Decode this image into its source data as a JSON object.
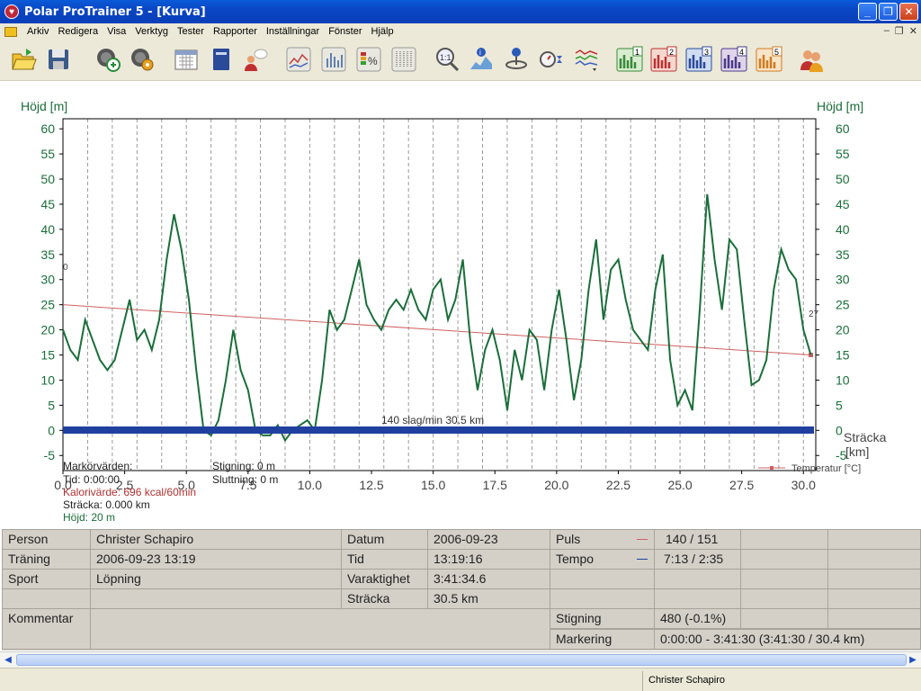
{
  "window": {
    "title": "Polar ProTrainer 5 - [Kurva]"
  },
  "menu": {
    "items": [
      "Arkiv",
      "Redigera",
      "Visa",
      "Verktyg",
      "Tester",
      "Rapporter",
      "Inställningar",
      "Fönster",
      "Hjälp"
    ]
  },
  "toolbar": {
    "buttons": [
      "open-folder-icon",
      "save-icon",
      "sync-icon",
      "settings-icon",
      "calendar-icon",
      "diary-icon",
      "person-icon",
      "speech-icon",
      "curve-view-icon",
      "bar-view-icon",
      "percent-view-icon",
      "table-view-icon",
      "zoom-icon",
      "info-marker-icon",
      "cursor-icon",
      "stopwatch-icon",
      "multi-curve-icon",
      "zone-1-icon",
      "zone-2-icon",
      "zone-3-icon",
      "zone-4-icon",
      "zone-5-icon",
      "users-icon"
    ],
    "zone_labels": [
      "1",
      "2",
      "3",
      "4",
      "5"
    ]
  },
  "chart": {
    "ylabel_left": "Höjd [m]",
    "ylabel_right": "Höjd [m]",
    "xlabel_line1": "Sträcka",
    "xlabel_line2": "[km]",
    "bar_label": "140 slag/min 30.5 km",
    "temp_start_label": "0",
    "temp_end_label": "27",
    "legend_label": "Temperatur [°C]",
    "colors": {
      "altitude": "#1a6e3a",
      "temperature": "#d06060",
      "bar": "#2040a0",
      "axis_text": "#1a6e3a"
    }
  },
  "chart_data": {
    "type": "line",
    "xlim": [
      0,
      30.5
    ],
    "ylim": [
      -8,
      62
    ],
    "xticks": [
      "0.0",
      "2.5",
      "5.0",
      "7.5",
      "10.0",
      "12.5",
      "15.0",
      "17.5",
      "20.0",
      "22.5",
      "25.0",
      "27.5",
      "30.0"
    ],
    "yticks": [
      "60",
      "55",
      "50",
      "45",
      "40",
      "35",
      "30",
      "25",
      "20",
      "15",
      "10",
      "5",
      "0",
      "-5"
    ],
    "series": [
      {
        "name": "Höjd",
        "x": [
          0,
          0.3,
          0.6,
          0.9,
          1.2,
          1.5,
          1.8,
          2.1,
          2.4,
          2.7,
          3,
          3.3,
          3.6,
          3.9,
          4.2,
          4.5,
          4.8,
          5.1,
          5.4,
          5.7,
          6,
          6.3,
          6.6,
          6.9,
          7.2,
          7.5,
          7.8,
          8.1,
          8.4,
          8.7,
          9,
          9.3,
          9.6,
          9.9,
          10.2,
          10.5,
          10.8,
          11.1,
          11.4,
          11.7,
          12,
          12.3,
          12.6,
          12.9,
          13.2,
          13.5,
          13.8,
          14.1,
          14.4,
          14.7,
          15,
          15.3,
          15.6,
          15.9,
          16.2,
          16.5,
          16.8,
          17.1,
          17.4,
          17.7,
          18,
          18.3,
          18.6,
          18.9,
          19.2,
          19.5,
          19.8,
          20.1,
          20.4,
          20.7,
          21,
          21.3,
          21.6,
          21.9,
          22.2,
          22.5,
          22.8,
          23.1,
          23.4,
          23.7,
          24,
          24.3,
          24.6,
          24.9,
          25.2,
          25.5,
          25.8,
          26.1,
          26.4,
          26.7,
          27,
          27.3,
          27.6,
          27.9,
          28.2,
          28.5,
          28.8,
          29.1,
          29.4,
          29.7,
          30,
          30.3
        ],
        "y": [
          20,
          16,
          14,
          22,
          18,
          14,
          12,
          14,
          20,
          26,
          18,
          20,
          16,
          22,
          34,
          43,
          36,
          26,
          12,
          0,
          -1,
          2,
          10,
          20,
          12,
          8,
          0,
          -1,
          -1,
          1,
          -2,
          0,
          1,
          2,
          0,
          10,
          24,
          20,
          22,
          28,
          34,
          25,
          22,
          20,
          24,
          26,
          24,
          28,
          24,
          22,
          28,
          30,
          22,
          26,
          34,
          18,
          8,
          16,
          20,
          14,
          4,
          16,
          10,
          20,
          18,
          8,
          20,
          28,
          18,
          6,
          14,
          28,
          38,
          22,
          32,
          34,
          26,
          20,
          18,
          16,
          28,
          35,
          14,
          5,
          8,
          4,
          24,
          47,
          34,
          24,
          38,
          36,
          22,
          9,
          10,
          14,
          28,
          36,
          32,
          30,
          20,
          15
        ]
      },
      {
        "name": "Temperatur [°C]",
        "x": [
          0,
          30.3
        ],
        "y": [
          25,
          15
        ]
      }
    ]
  },
  "markers": {
    "title": "Markörvärden:",
    "tid": "Tid: 0:00:00",
    "kalori": "Kalorivärde: 696 kcal/60min",
    "stracka": "Sträcka: 0.000 km",
    "hojd": "Höjd: 20 m",
    "stigning": "Stigning: 0 m",
    "sluttning": "Sluttning: 0 m"
  },
  "info": {
    "person_label": "Person",
    "person": "Christer Schapiro",
    "traning_label": "Träning",
    "traning": "2006-09-23 13:19",
    "sport_label": "Sport",
    "sport": "Löpning",
    "kommentar_label": "Kommentar",
    "datum_label": "Datum",
    "datum": "2006-09-23",
    "tid_label": "Tid",
    "tid": "13:19:16",
    "varaktighet_label": "Varaktighet",
    "varaktighet": "3:41:34.6",
    "stracka_label": "Sträcka",
    "stracka": "30.5 km",
    "puls_label": "Puls",
    "puls": "140 / 151",
    "tempo_label": "Tempo",
    "tempo": "7:13 / 2:35",
    "stigning_label": "Stigning",
    "stigning": "480 (-0.1%)",
    "markering_label": "Markering",
    "markering": "0:00:00 - 3:41:30 (3:41:30 / 30.4 km)"
  },
  "status": {
    "user": "Christer Schapiro"
  }
}
